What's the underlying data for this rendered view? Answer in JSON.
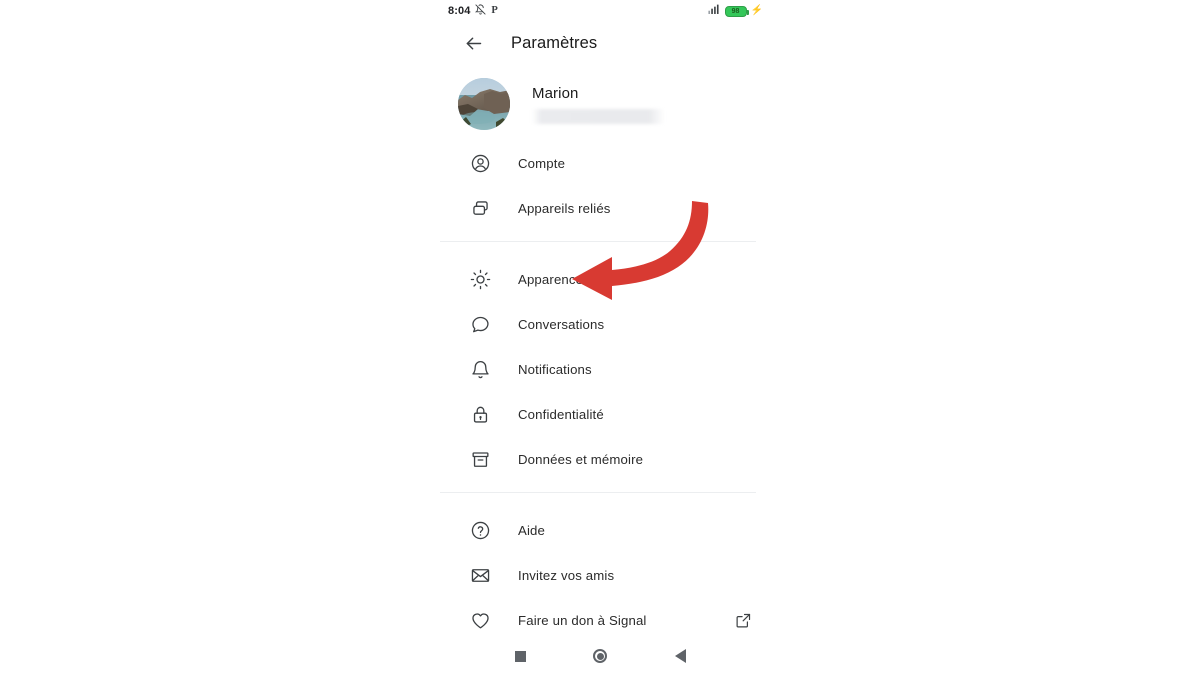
{
  "status_bar": {
    "time": "8:04",
    "mute_icon": "bell-muted-icon",
    "p_indicator": "P",
    "signal_icon": "cellular-signal-icon",
    "battery_level": "98",
    "charging_icon": "charging-bolt-icon"
  },
  "toolbar": {
    "back_icon": "back-arrow-icon",
    "title": "Paramètres"
  },
  "profile": {
    "avatar_icon": "avatar",
    "name": "Marion",
    "phone_redacted": ""
  },
  "groups": [
    {
      "name": "account-group",
      "items": [
        {
          "icon": "person-circle-icon",
          "label": "Compte"
        },
        {
          "icon": "linked-devices-icon",
          "label": "Appareils reliés"
        }
      ]
    },
    {
      "name": "preferences-group",
      "items": [
        {
          "icon": "sun-icon",
          "label": "Apparence"
        },
        {
          "icon": "chat-bubble-icon",
          "label": "Conversations"
        },
        {
          "icon": "bell-icon",
          "label": "Notifications"
        },
        {
          "icon": "lock-icon",
          "label": "Confidentialité"
        },
        {
          "icon": "archive-box-icon",
          "label": "Données et mémoire"
        }
      ]
    },
    {
      "name": "support-group",
      "items": [
        {
          "icon": "question-circle-icon",
          "label": "Aide"
        },
        {
          "icon": "envelope-icon",
          "label": "Invitez vos amis"
        },
        {
          "icon": "heart-icon",
          "label": "Faire un don à Signal",
          "trailing_icon": "external-link-icon"
        }
      ]
    }
  ],
  "nav_bar": {
    "recents_icon": "recents-square-icon",
    "home_icon": "home-circle-icon",
    "back_icon": "back-triangle-icon"
  },
  "annotation": {
    "arrow_icon": "curved-arrow-left-icon",
    "color": "#D83A32",
    "points_at": "Apparence"
  }
}
